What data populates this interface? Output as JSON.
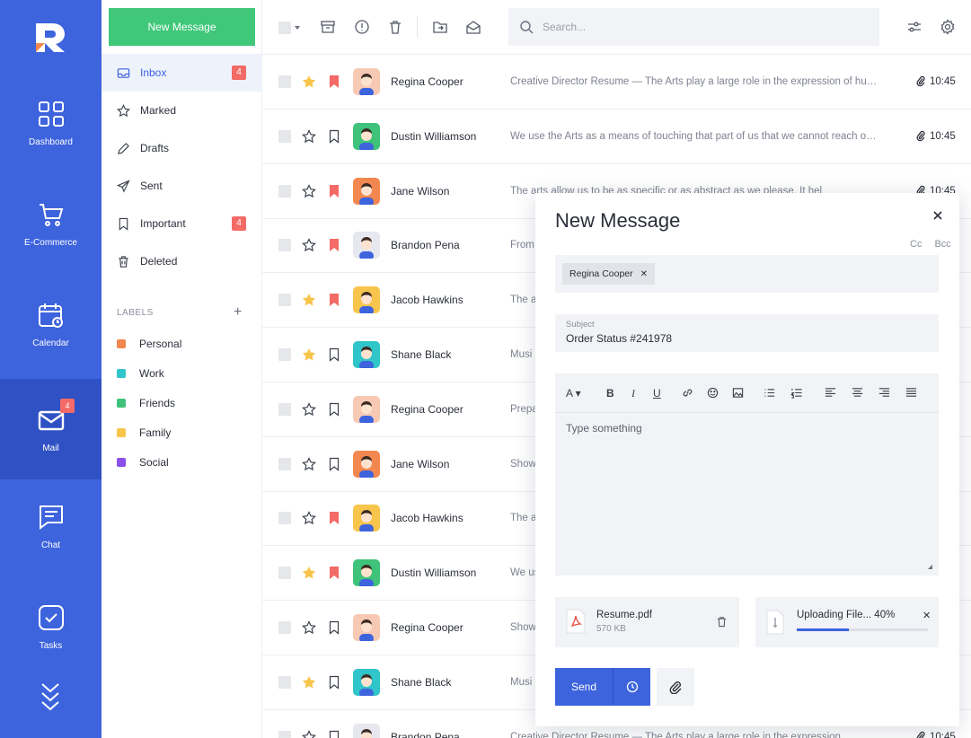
{
  "rail": {
    "items": [
      {
        "label": "Dashboard",
        "icon": "grid-icon"
      },
      {
        "label": "E-Commerce",
        "icon": "cart-icon"
      },
      {
        "label": "Calendar",
        "icon": "calendar-icon"
      },
      {
        "label": "Mail",
        "icon": "mail-icon",
        "badge": "4"
      },
      {
        "label": "Chat",
        "icon": "chat-icon"
      },
      {
        "label": "Tasks",
        "icon": "check-icon"
      }
    ]
  },
  "sidebar": {
    "new_message": "New Message",
    "folders": [
      {
        "label": "Inbox",
        "count": "4"
      },
      {
        "label": "Marked"
      },
      {
        "label": "Drafts"
      },
      {
        "label": "Sent"
      },
      {
        "label": "Important",
        "count": "4"
      },
      {
        "label": "Deleted"
      }
    ],
    "labels_title": "LABELS",
    "labels": [
      {
        "label": "Personal",
        "color": "#f2884f"
      },
      {
        "label": "Work",
        "color": "#2fc5c9"
      },
      {
        "label": "Friends",
        "color": "#3fc279"
      },
      {
        "label": "Family",
        "color": "#f8c54c"
      },
      {
        "label": "Social",
        "color": "#8a4fe8"
      }
    ]
  },
  "toolbar": {
    "search_placeholder": "Search..."
  },
  "mails": [
    {
      "name": "Regina Cooper",
      "snippet": "Creative Director Resume — The Arts play a large role in the expression of human emotions and ideas",
      "time": "10:45",
      "starred": true,
      "flagged": true,
      "attachment": true,
      "avatar": "peach"
    },
    {
      "name": "Dustin Williamson",
      "snippet": "We use the Arts as a means of touching that part of us that we cannot reach otherwise",
      "time": "10:45",
      "starred": false,
      "flagged": false,
      "attachment": true,
      "avatar": "green"
    },
    {
      "name": "Jane Wilson",
      "snippet": "The arts allow us to be as specific or as abstract as we please. It hel",
      "time": "10:45",
      "starred": false,
      "flagged": true,
      "attachment": true,
      "avatar": "orange"
    },
    {
      "name": "Brandon Pena",
      "snippet": "From",
      "time": "",
      "starred": false,
      "flagged": true,
      "attachment": false,
      "avatar": "light"
    },
    {
      "name": "Jacob Hawkins",
      "snippet": "The a",
      "time": "",
      "starred": true,
      "flagged": true,
      "attachment": false,
      "avatar": "yellow"
    },
    {
      "name": "Shane Black",
      "snippet": "Musi",
      "time": "",
      "starred": true,
      "flagged": false,
      "attachment": false,
      "avatar": "cyan"
    },
    {
      "name": "Regina Cooper",
      "snippet": "Prepa",
      "time": "",
      "starred": false,
      "flagged": false,
      "attachment": false,
      "avatar": "peach"
    },
    {
      "name": "Jane Wilson",
      "snippet": "Show",
      "time": "",
      "starred": false,
      "flagged": false,
      "attachment": false,
      "avatar": "orange"
    },
    {
      "name": "Jacob Hawkins",
      "snippet": "The a",
      "time": "",
      "starred": false,
      "flagged": true,
      "attachment": false,
      "avatar": "yellow"
    },
    {
      "name": "Dustin Williamson",
      "snippet": "We us",
      "time": "",
      "starred": true,
      "flagged": true,
      "attachment": false,
      "avatar": "green"
    },
    {
      "name": "Regina Cooper",
      "snippet": "Show",
      "time": "",
      "starred": false,
      "flagged": false,
      "attachment": false,
      "avatar": "peach"
    },
    {
      "name": "Shane Black",
      "snippet": "Musi",
      "time": "",
      "starred": true,
      "flagged": false,
      "attachment": false,
      "avatar": "cyan"
    },
    {
      "name": "Brandon Pena",
      "snippet": "Creative Director Resume — The Arts play a large role in the expression",
      "time": "10:45",
      "starred": false,
      "flagged": false,
      "attachment": true,
      "avatar": "light"
    }
  ],
  "compose": {
    "title": "New Message",
    "cc": "Cc",
    "bcc": "Bcc",
    "recipient": "Regina Cooper",
    "subject_label": "Subject",
    "subject": "Order Status #241978",
    "body_placeholder": "Type something",
    "attachment": {
      "name": "Resume.pdf",
      "size": "570 KB"
    },
    "upload": {
      "label": "Uploading File... 40%",
      "progress": 0.4
    },
    "send": "Send"
  },
  "colors": {
    "accent": "#3d63dd",
    "green": "#40c77a",
    "badge": "#f36a66",
    "star": "#f8c54c",
    "flag": "#f36a66"
  }
}
